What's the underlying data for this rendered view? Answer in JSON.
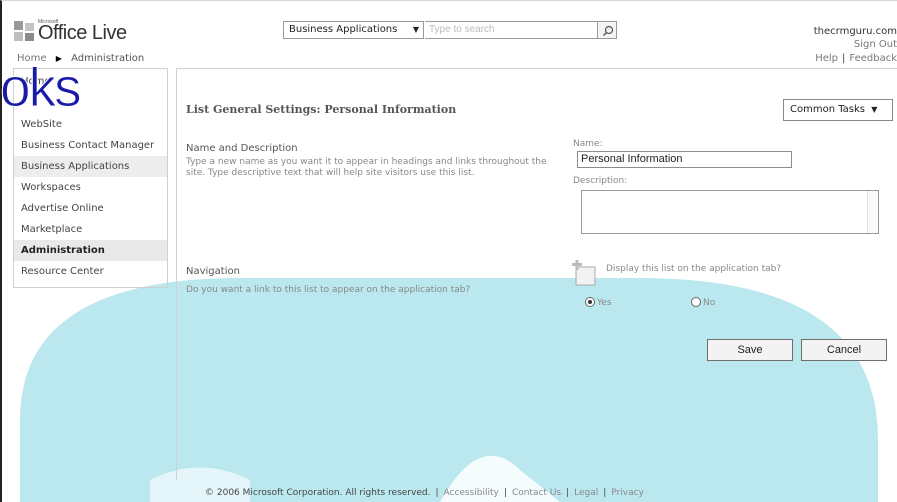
{
  "header": {
    "logo_small": "Microsoft",
    "logo_text": "Office Live",
    "breadcrumb": {
      "home": "Home",
      "current": "Administration"
    },
    "search": {
      "scope": "Business Applications",
      "placeholder": "Type to search"
    },
    "user": "thecrmguru.com",
    "sign_out": "Sign Out",
    "help": "Help",
    "feedback": "Feedback"
  },
  "overlay_text": "oks",
  "nav": {
    "items": [
      {
        "label": "Home"
      },
      {
        "label": "WebSite"
      },
      {
        "label": "Business Contact Manager"
      },
      {
        "label": "Business Applications"
      },
      {
        "label": "Workspaces"
      },
      {
        "label": "Advertise Online"
      },
      {
        "label": "Marketplace"
      },
      {
        "label": "Administration",
        "selected": true
      },
      {
        "label": "Resource Center"
      }
    ]
  },
  "main": {
    "title": "List General Settings: Personal Information",
    "common_tasks": "Common Tasks",
    "name_section": {
      "title": "Name and Description",
      "description": "Type a new name as you want it to appear in headings and links throughout the site. Type descriptive text that will help site visitors use this list.",
      "name_label": "Name:",
      "name_value": "Personal Information",
      "description_label": "Description:"
    },
    "navigation_section": {
      "title": "Navigation",
      "description": "Do you want a link to this list to appear on the application tab?",
      "checkbox_label": "Display this list on the application tab?",
      "yes_label": "Yes",
      "no_label": "No",
      "selected": "Yes"
    },
    "save_label": "Save",
    "cancel_label": "Cancel"
  },
  "footer": {
    "copyright": "© 2006 Microsoft Corporation. All rights reserved.",
    "links": [
      "Accessibility",
      "Contact Us",
      "Legal",
      "Privacy"
    ]
  },
  "colors": {
    "overlay": "#1a1aa8",
    "watermark": "#7fd3e0",
    "selected_nav_bg": "#e9e9e9"
  }
}
